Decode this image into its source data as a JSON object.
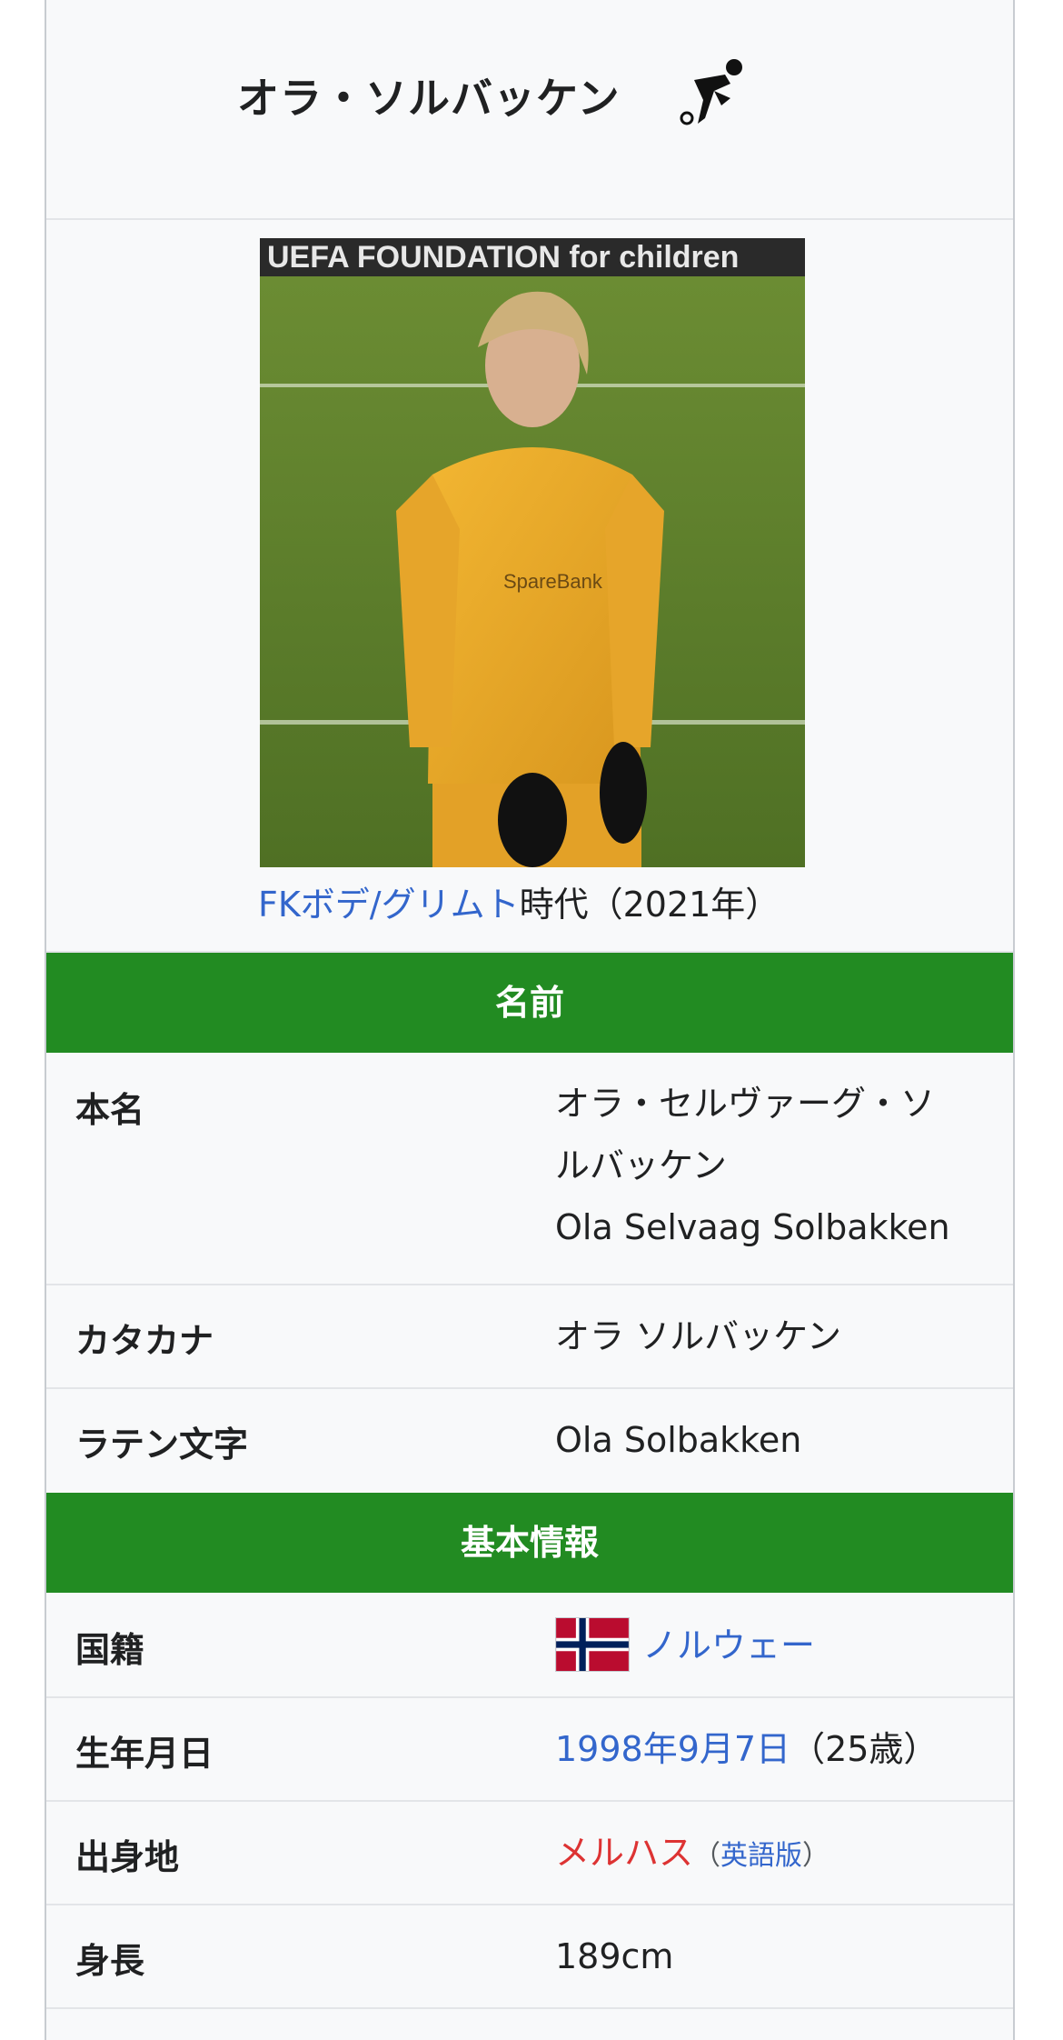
{
  "title": "オラ・ソルバッケン",
  "photo": {
    "banner_text": "UEFA FOUNDATION for children"
  },
  "caption": {
    "link": "FKボデ/グリムト",
    "rest": "時代（2021年）"
  },
  "sections": {
    "name": "名前",
    "basic": "基本情報"
  },
  "rows": {
    "real_name": {
      "label": "本名",
      "value_line1": "オラ・セルヴァーグ・ソ",
      "value_line2": "ルバッケン",
      "value_line3": "Ola Selvaag Solbakken"
    },
    "katakana": {
      "label": "カタカナ",
      "value": "オラ ソルバッケン"
    },
    "latin": {
      "label": "ラテン文字",
      "value": "Ola Solbakken"
    },
    "nationality": {
      "label": "国籍",
      "value": "ノルウェー"
    },
    "birth": {
      "label": "生年月日",
      "value_link": "1998年9月7日",
      "value_rest": "（25歳）"
    },
    "birthplace": {
      "label": "出身地",
      "value_link": "メルハス",
      "paren_open": "（",
      "english": "英語版",
      "paren_close": "）"
    },
    "height": {
      "label": "身長",
      "value": "189cm"
    }
  },
  "colors": {
    "section_bg": "#228b22",
    "link": "#3366cc",
    "redlink": "#d33333",
    "infobox_bg": "#f8f9fa"
  },
  "icons": {
    "title_icon": "soccer-player-icon",
    "flag": "norway-flag-icon"
  }
}
